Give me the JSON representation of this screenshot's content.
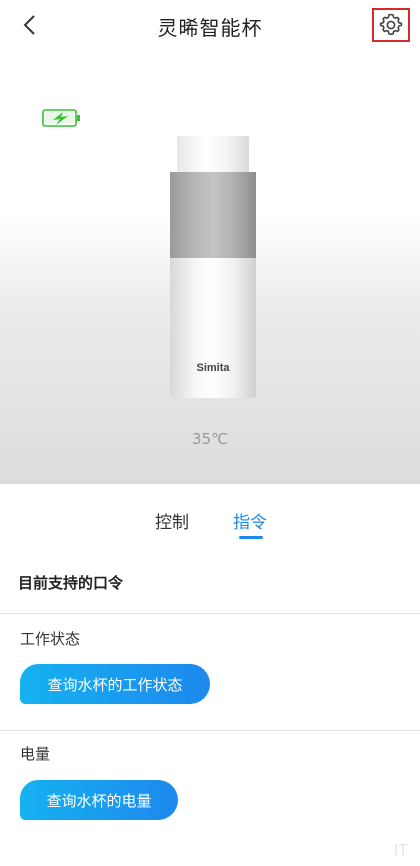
{
  "header": {
    "title": "灵晞智能杯"
  },
  "device": {
    "brand": "Simita",
    "temperature": "35℃",
    "battery_charging": true
  },
  "tabs": [
    {
      "label": "控制",
      "active": false
    },
    {
      "label": "指令",
      "active": true
    }
  ],
  "commands": {
    "header": "目前支持的口令",
    "groups": [
      {
        "label": "工作状态",
        "button": "查询水杯的工作状态"
      },
      {
        "label": "电量",
        "button": "查询水杯的电量"
      }
    ]
  },
  "watermark": "IT",
  "colors": {
    "accent": "#1a8be9",
    "pill_start": "#15b2f0",
    "pill_end": "#1d88ee",
    "battery": "#35c236",
    "highlight_box": "#d52a2a"
  }
}
